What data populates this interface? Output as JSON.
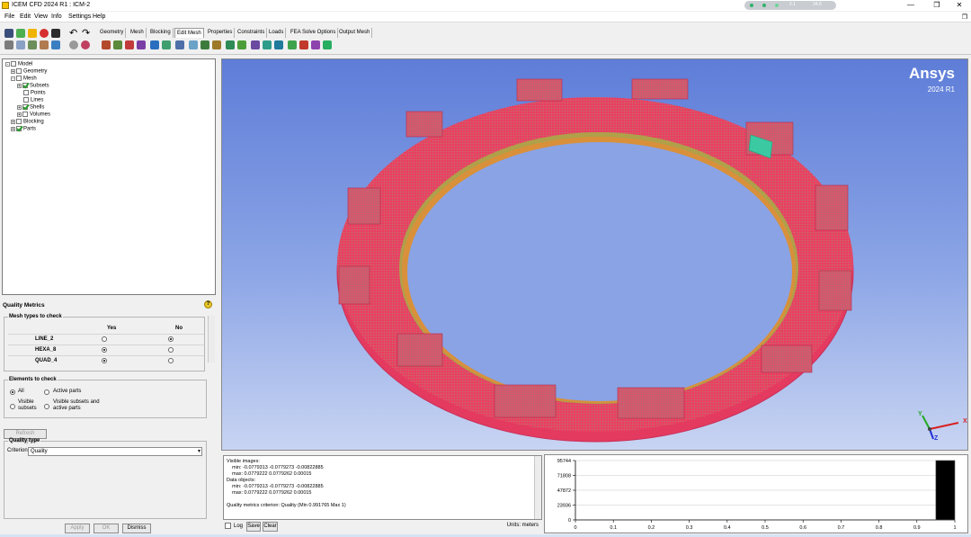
{
  "window": {
    "title": "ICEM CFD 2024 R1 : ICM-2",
    "perf_pill": {
      "value_1": "2.1",
      "value_2": "34.6"
    },
    "controls": {
      "minimize": "—",
      "maximize": "❐",
      "close": "✕"
    },
    "restore_glyph": "❐"
  },
  "menu": [
    "File",
    "Edit",
    "View",
    "Info",
    "Settings",
    "Help"
  ],
  "toolbar": {
    "tabs": [
      "Geometry",
      "Mesh",
      "Blocking",
      "Edit Mesh",
      "Properties",
      "Constraints",
      "Loads",
      "FEA Solve Options",
      "Output Mesh"
    ],
    "active_tab": "Edit Mesh",
    "undo_glyph": "↶",
    "redo_glyph": "↷"
  },
  "model_tree": [
    {
      "label": "Model",
      "depth": 0,
      "expander": "-",
      "checked": false
    },
    {
      "label": "Geometry",
      "depth": 1,
      "expander": "+",
      "checked": false
    },
    {
      "label": "Mesh",
      "depth": 1,
      "expander": "-",
      "checked": false
    },
    {
      "label": "Subsets",
      "depth": 2,
      "expander": "+",
      "checked": true
    },
    {
      "label": "Points",
      "depth": 2,
      "expander": "",
      "checked": false
    },
    {
      "label": "Lines",
      "depth": 2,
      "expander": "",
      "checked": false
    },
    {
      "label": "Shells",
      "depth": 2,
      "expander": "+",
      "checked": true
    },
    {
      "label": "Volumes",
      "depth": 2,
      "expander": "+",
      "checked": false
    },
    {
      "label": "Blocking",
      "depth": 1,
      "expander": "+",
      "checked": false
    },
    {
      "label": "Parts",
      "depth": 1,
      "expander": "+",
      "checked": true
    }
  ],
  "quality_metrics": {
    "title": "Quality Metrics",
    "help_glyph": "?",
    "mesh_types": {
      "legend": "Mesh types to check",
      "col_yes": "Yes",
      "col_no": "No",
      "rows": [
        {
          "name": "LINE_2",
          "selected": "No"
        },
        {
          "name": "HEXA_8",
          "selected": "Yes"
        },
        {
          "name": "QUAD_4",
          "selected": "Yes"
        }
      ]
    },
    "elements": {
      "legend": "Elements to check",
      "options": [
        "All",
        "Active parts",
        "Visible subsets",
        "Visible subsets and active parts"
      ],
      "selected": "All"
    },
    "refresh_label": "Refresh Histogram",
    "quality_type": {
      "legend": "Quality type",
      "criterion_label": "Criterion",
      "criterion_value": "Quality"
    },
    "buttons": {
      "apply": "Apply",
      "ok": "OK",
      "dismiss": "Dismiss"
    }
  },
  "viewport": {
    "logo_word": "Ansys",
    "logo_version": "2024 R1",
    "axes": {
      "x": "X",
      "y": "Y",
      "z": "Z"
    }
  },
  "messages": {
    "lines": [
      "Visible images:",
      "    min: -0.0779313 -0.0779273 -0.00822885",
      "    max: 0.0779222 0.0779262 0.00015",
      "Data objects:",
      "    min: -0.0779313 -0.0779273 -0.00822885",
      "    max: 0.0779222 0.0779262 0.00015",
      "",
      "Quality metrics criterion: Quality (Min 0.991765 Max 1)"
    ],
    "log_label": "Log",
    "save_label": "Save",
    "clear_label": "Clear",
    "units": "Units: meters"
  },
  "chart_data": {
    "type": "bar",
    "xlim": [
      0,
      1
    ],
    "x_ticks": [
      "0",
      "0.1",
      "0.2",
      "0.3",
      "0.4",
      "0.5",
      "0.6",
      "0.7",
      "0.8",
      "0.9",
      "1"
    ],
    "y_ticks": [
      "0",
      "23936",
      "47872",
      "71808",
      "95744"
    ],
    "ylim": [
      0,
      95744
    ],
    "bars": [
      {
        "x_start": 0.95,
        "x_end": 1.0,
        "value": 95744
      }
    ],
    "grid": true
  }
}
